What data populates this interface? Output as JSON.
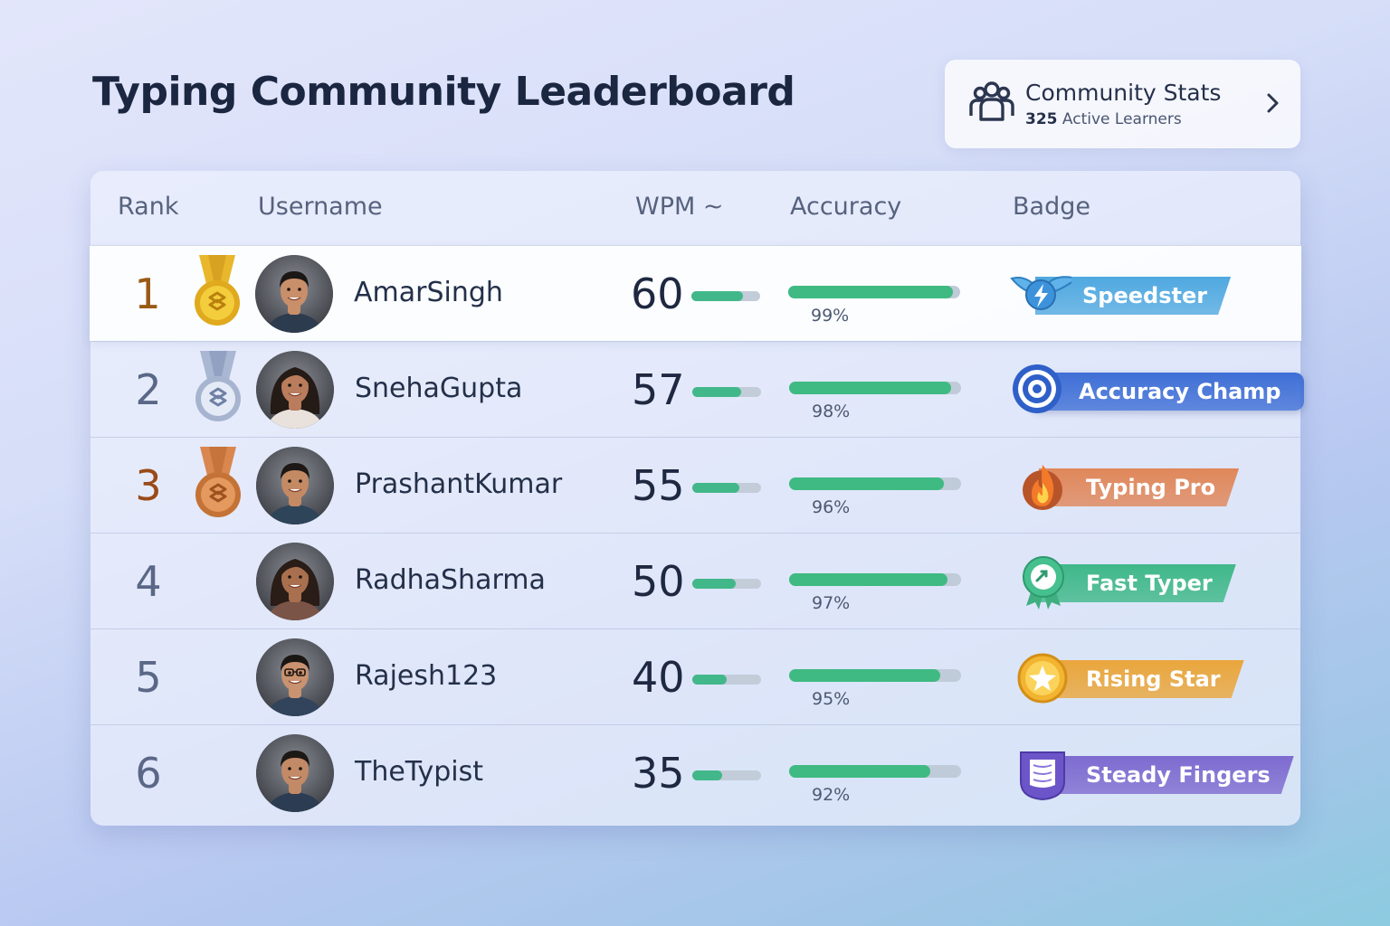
{
  "title": "Typing Community Leaderboard",
  "stats": {
    "title": "Community Stats",
    "count": "325",
    "count_label": "Active Learners",
    "icon": "people-group-icon",
    "chevron": "chevron-right-icon"
  },
  "table": {
    "headers": {
      "rank": "Rank",
      "username": "Username",
      "wpm": "WPM ~",
      "accuracy": "Accuracy",
      "badge": "Badge"
    },
    "rows": [
      {
        "rank": "1",
        "medal": "gold-medal-icon",
        "username": "AmarSingh",
        "wpm": "60",
        "wpm_value": 60,
        "accuracy": "99%",
        "accuracy_value": 0.99,
        "badge": "Speedster",
        "badge_icon": "winged-lightning-icon",
        "badge_color": "#4fa8e0"
      },
      {
        "rank": "2",
        "medal": "silver-medal-icon",
        "username": "SnehaGupta",
        "wpm": "57",
        "wpm_value": 57,
        "accuracy": "98%",
        "accuracy_value": 0.98,
        "badge": "Accuracy Champ",
        "badge_icon": "target-icon",
        "badge_color": "#3f6fd6"
      },
      {
        "rank": "3",
        "medal": "bronze-medal-icon",
        "username": "PrashantKumar",
        "wpm": "55",
        "wpm_value": 55,
        "accuracy": "96%",
        "accuracy_value": 0.96,
        "badge": "Typing Pro",
        "badge_icon": "flame-icon",
        "badge_color": "#e0875a"
      },
      {
        "rank": "4",
        "medal": "",
        "username": "RadhaSharma",
        "wpm": "50",
        "wpm_value": 50,
        "accuracy": "97%",
        "accuracy_value": 0.97,
        "badge": "Fast Typer",
        "badge_icon": "award-rosette-icon",
        "badge_color": "#3fb889"
      },
      {
        "rank": "5",
        "medal": "",
        "username": "Rajesh123",
        "wpm": "40",
        "wpm_value": 40,
        "accuracy": "95%",
        "accuracy_value": 0.95,
        "badge": "Rising Star",
        "badge_icon": "star-coin-icon",
        "badge_color": "#eaa63c"
      },
      {
        "rank": "6",
        "medal": "",
        "username": "TheTypist",
        "wpm": "35",
        "wpm_value": 35,
        "accuracy": "92%",
        "accuracy_value": 0.92,
        "badge": "Steady Fingers",
        "badge_icon": "book-shield-icon",
        "badge_color": "#7e6bd0"
      }
    ]
  },
  "colors": {
    "accent_green": "#3fba82",
    "track_gray": "#bfcbd8",
    "gold": "#e8b72c",
    "silver": "#a9b7d3",
    "bronze": "#d9874e"
  }
}
